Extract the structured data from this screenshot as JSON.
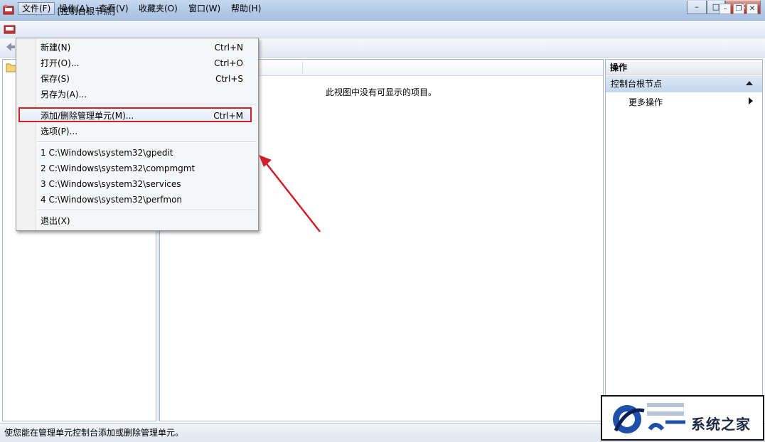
{
  "window": {
    "title": "控制台1 - [控制台根节点]",
    "buttons": {
      "minimize": "–",
      "maximize": "□",
      "close": "✕"
    }
  },
  "menubar": {
    "items": [
      "文件(F)",
      "操作(A)",
      "查看(V)",
      "收藏夹(O)",
      "窗口(W)",
      "帮助(H)"
    ],
    "active": "文件(F)",
    "mdi_buttons": {
      "minimize": "–",
      "restore": "❐",
      "close": "✕"
    }
  },
  "file_menu": {
    "items": [
      {
        "label": "新建(N)",
        "shortcut": "Ctrl+N"
      },
      {
        "label": "打开(O)...",
        "shortcut": "Ctrl+O"
      },
      {
        "label": "保存(S)",
        "shortcut": "Ctrl+S"
      },
      {
        "label": "另存为(A)...",
        "shortcut": ""
      },
      {
        "label": "添加/删除管理单元(M)...",
        "shortcut": "Ctrl+M"
      },
      {
        "label": "选项(P)...",
        "shortcut": ""
      },
      {
        "label": "1 C:\\Windows\\system32\\gpedit",
        "shortcut": ""
      },
      {
        "label": "2 C:\\Windows\\system32\\compmgmt",
        "shortcut": ""
      },
      {
        "label": "3 C:\\Windows\\system32\\services",
        "shortcut": ""
      },
      {
        "label": "4 C:\\Windows\\system32\\perfmon",
        "shortcut": ""
      },
      {
        "label": "退出(X)",
        "shortcut": ""
      }
    ],
    "highlight_color": "#d0202a"
  },
  "center": {
    "empty_message": "此视图中没有可显示的项目。"
  },
  "actions_pane": {
    "title": "操作",
    "section": "控制台根节点",
    "more": "更多操作"
  },
  "status": {
    "text": "使您能在管理单元控制台添加或删除管理单元。"
  },
  "watermark": {
    "text": "系统之家"
  },
  "colors": {
    "annotation_red": "#d0202a",
    "titlebar": "#b2c9e6"
  }
}
